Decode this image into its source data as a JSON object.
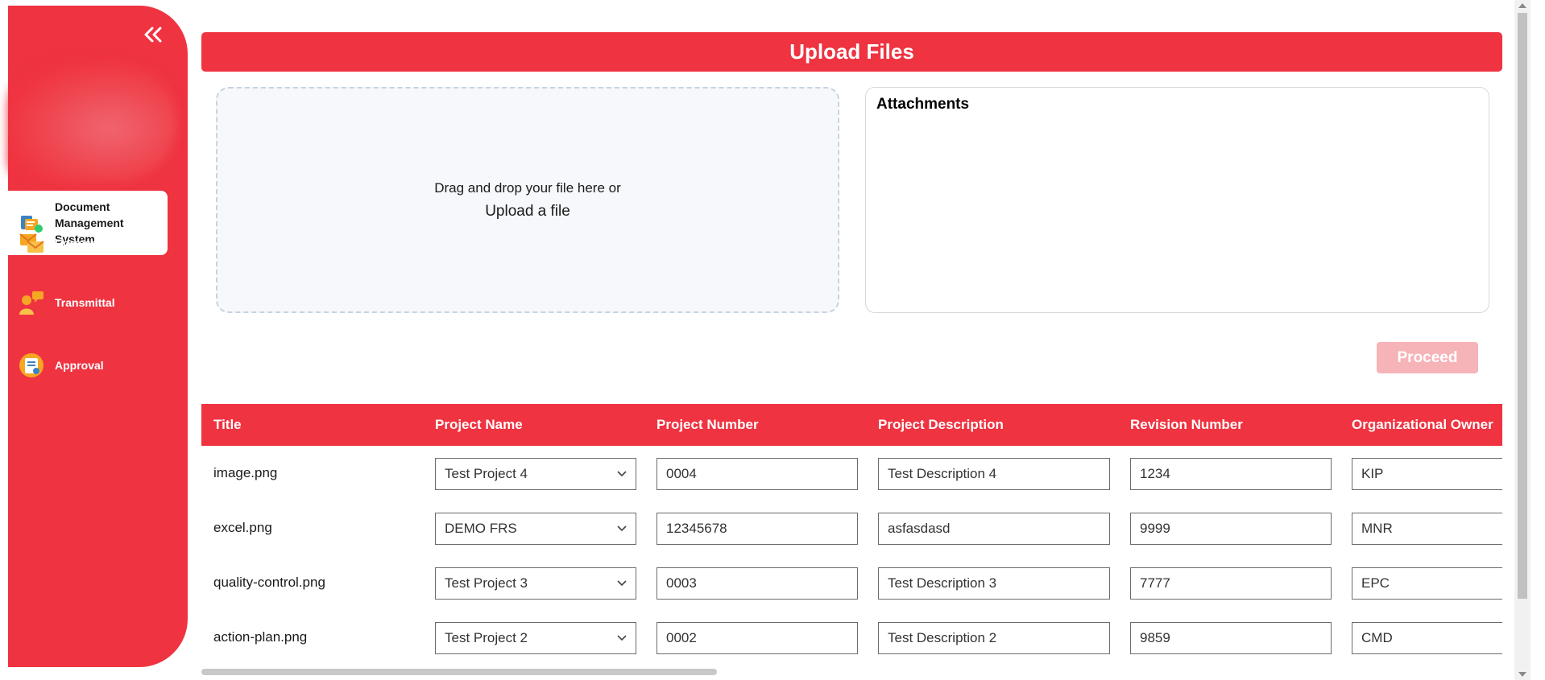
{
  "sidebar": {
    "collapse_icon": "double-chevron-left-icon",
    "items": [
      {
        "label": "Document Management System",
        "icon": "document-management-icon",
        "active": true
      },
      {
        "label": "Correspondence",
        "icon": "correspondence-icon",
        "active": false
      },
      {
        "label": "Transmittal",
        "icon": "transmittal-icon",
        "active": false
      },
      {
        "label": "Approval",
        "icon": "approval-icon",
        "active": false
      }
    ]
  },
  "upload": {
    "title": "Upload Files",
    "drop_hint": "Drag and drop your file here or",
    "upload_link": "Upload a file",
    "attachments_title": "Attachments",
    "proceed_label": "Proceed"
  },
  "table": {
    "headers": [
      "Title",
      "Project Name",
      "Project Number",
      "Project Description",
      "Revision Number",
      "Organizational Owner"
    ],
    "rows": [
      {
        "title": "image.png",
        "project_name": "Test Project 4",
        "project_number": "0004",
        "project_description": "Test Description 4",
        "revision_number": "1234",
        "org_owner": "KIP"
      },
      {
        "title": "excel.png",
        "project_name": "DEMO FRS",
        "project_number": "12345678",
        "project_description": "asfasdasd",
        "revision_number": "9999",
        "org_owner": "MNR"
      },
      {
        "title": "quality-control.png",
        "project_name": "Test Project 3",
        "project_number": "0003",
        "project_description": "Test Description 3",
        "revision_number": "7777",
        "org_owner": "EPC"
      },
      {
        "title": "action-plan.png",
        "project_name": "Test Project 2",
        "project_number": "0002",
        "project_description": "Test Description 2",
        "revision_number": "9859",
        "org_owner": "CMD"
      }
    ]
  },
  "colors": {
    "brand_red": "#ef3340",
    "proceed_disabled": "#f6b3b8"
  }
}
